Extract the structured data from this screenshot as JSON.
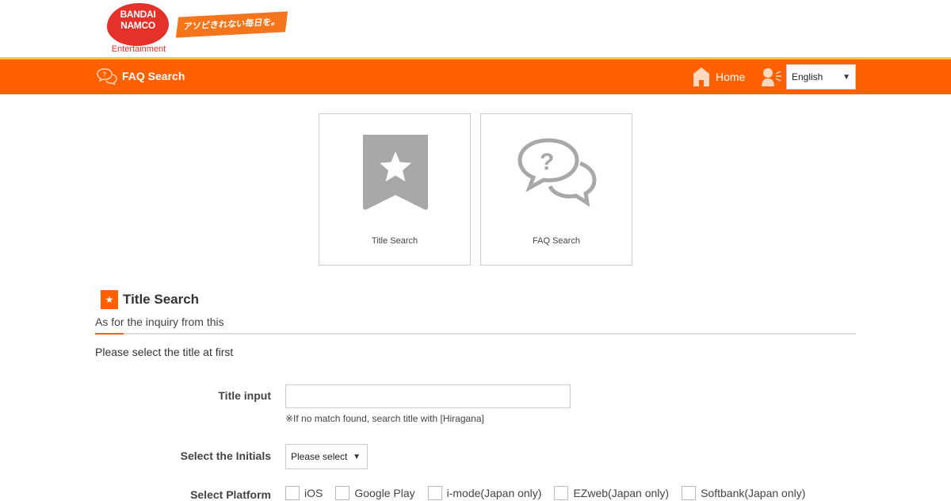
{
  "brand": {
    "logo_text": "BANDAI NAMCO",
    "logo_sub": "Entertainment",
    "tagline": "アソビきれない毎日を。"
  },
  "navbar": {
    "faq_label": "FAQ Search",
    "home_label": "Home",
    "language_value": "English"
  },
  "cards": [
    {
      "label": "Title Search",
      "icon": "bookmark-star-icon"
    },
    {
      "label": "FAQ Search",
      "icon": "speech-bubbles-question-icon"
    }
  ],
  "section": {
    "title": "Title Search",
    "subtitle": "As for the inquiry from this",
    "intro": "Please select the title at first"
  },
  "form": {
    "title_input_label": "Title input",
    "title_input_value": "",
    "title_input_hint": "※If no match found, search title with [Hiragana]",
    "initials_label": "Select the Initials",
    "initials_value": "Please select",
    "platform_label": "Select Platform",
    "platforms": [
      "iOS",
      "Google Play",
      "i-mode(Japan only)",
      "EZweb(Japan only)",
      "Softbank(Japan only)"
    ]
  },
  "colors": {
    "accent": "#ff6100",
    "accent_stripe": "#ffc24a",
    "logo_red": "#e4322b",
    "icon_gray": "#a8a8a8"
  }
}
